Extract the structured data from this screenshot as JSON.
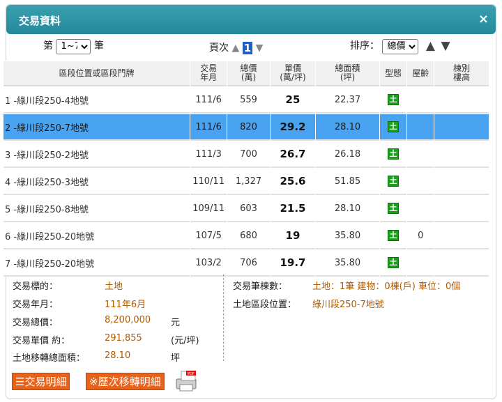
{
  "dialog": {
    "title": "交易資料",
    "close_label": "×"
  },
  "toolbar": {
    "range_prefix": "第",
    "range_value": "1~7",
    "range_suffix": "筆",
    "page_label": "頁次",
    "page_number": "1",
    "sort_label": "排序：",
    "sort_value": "總價"
  },
  "table": {
    "headers": [
      "區段位置或區段門牌",
      "交易\n年月",
      "總價\n(萬)",
      "單價\n(萬/坪)",
      "總面積\n(坪)",
      "型態",
      "屋齡",
      "棟別\n樓高"
    ],
    "rows": [
      {
        "addr": "1  -綠川段250-4地號",
        "date": "111/6",
        "total": "559",
        "unit": "25",
        "area": "22.37",
        "type": "土",
        "age": "",
        "floor": ""
      },
      {
        "addr": "2  -綠川段250-7地號",
        "date": "111/6",
        "total": "820",
        "unit": "29.2",
        "area": "28.10",
        "type": "土",
        "age": "",
        "floor": ""
      },
      {
        "addr": "3  -綠川段250-2地號",
        "date": "111/3",
        "total": "700",
        "unit": "26.7",
        "area": "26.18",
        "type": "土",
        "age": "",
        "floor": ""
      },
      {
        "addr": "4  -綠川段250-3地號",
        "date": "110/11",
        "total": "1,327",
        "unit": "25.6",
        "area": "51.85",
        "type": "土",
        "age": "",
        "floor": ""
      },
      {
        "addr": "5  -綠川段250-8地號",
        "date": "109/11",
        "total": "603",
        "unit": "21.5",
        "area": "28.10",
        "type": "土",
        "age": "",
        "floor": ""
      },
      {
        "addr": "6  -綠川段250-20地號",
        "date": "107/5",
        "total": "680",
        "unit": "19",
        "area": "35.80",
        "type": "土",
        "age": "0",
        "floor": ""
      },
      {
        "addr": "7  -綠川段250-20地號",
        "date": "103/2",
        "total": "706",
        "unit": "19.7",
        "area": "35.80",
        "type": "土",
        "age": "",
        "floor": ""
      }
    ],
    "selected_row": 1
  },
  "details": {
    "target_label": "交易標的：",
    "target_value": "土地",
    "date_label": "交易年月：",
    "date_value": "111年6月",
    "total_label": "交易總價：",
    "total_value": "8,200,000",
    "total_unit": "元",
    "unit_label": "交易單價 約：",
    "unit_value": "291,855",
    "unit_unit": "(元/坪)",
    "area_label": "土地移轉總面積：",
    "area_value": "28.10",
    "area_unit": "坪",
    "count_label": "交易筆棟數：",
    "count_value": "土地：1筆 建物：0棟(戶) 車位：0個",
    "location_label": "土地區段位置：",
    "location_value": "綠川段250-7地號"
  },
  "buttons": {
    "detail_label": "☰交易明細",
    "history_label": "※歷次移轉明細",
    "pdf_label": "PDF"
  },
  "colors": {
    "titlebar": "#2a93a5",
    "selected_row": "#4aa3f0",
    "button": "#e8621a",
    "land_icon": "#1aa01a",
    "value_text": "#b05a00"
  }
}
